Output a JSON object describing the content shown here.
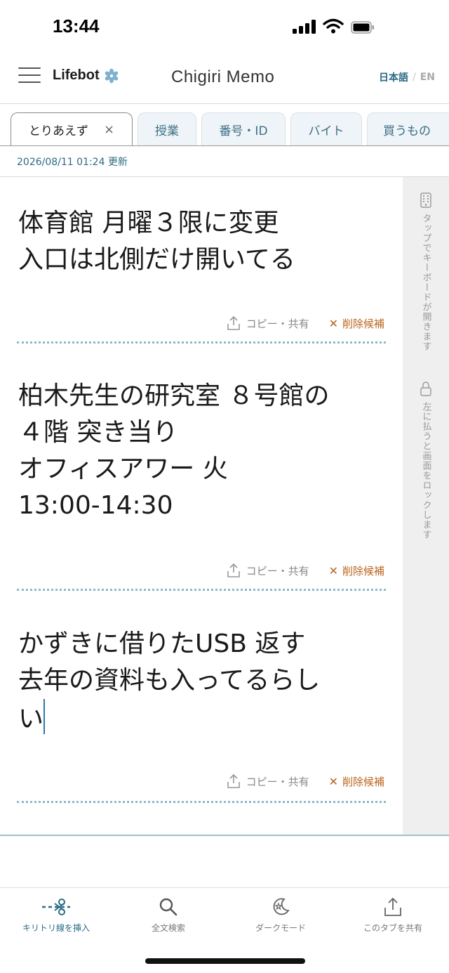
{
  "status_bar": {
    "time": "13:44"
  },
  "header": {
    "brand": "Lifebot",
    "title": "Chigiri Memo",
    "lang_ja": "日本語",
    "lang_sep": "/",
    "lang_en": "EN"
  },
  "tabs": [
    {
      "label": "とりあえず",
      "active": true,
      "close": "×"
    },
    {
      "label": "授業"
    },
    {
      "label": "番号・ID"
    },
    {
      "label": "バイト"
    },
    {
      "label": "買うもの"
    }
  ],
  "updated": "2026/08/11 01:24 更新",
  "memos": [
    {
      "text": "体育館 月曜３限に変更\n入口は北側だけ開いてる",
      "copy_label": "コピー・共有",
      "delete_label": "削除候補"
    },
    {
      "text": "柏木先生の研究室 ８号館の\n４階 突き当り\nオフィスアワー 火\n13:00-14:30",
      "copy_label": "コピー・共有",
      "delete_label": "削除候補"
    },
    {
      "text": "かずきに借りたUSB 返す\n去年の資料も入ってるらし\nい",
      "copy_label": "コピー・共有",
      "delete_label": "削除候補"
    }
  ],
  "side_rail": {
    "keyboard_hint": "タップでキーボードが開きます",
    "lock_hint": "左に払うと画面をロックします"
  },
  "bottom_nav": [
    {
      "label": "キリトリ線を挿入",
      "icon": "scissors-line-icon",
      "active": true
    },
    {
      "label": "全文検索",
      "icon": "search-icon"
    },
    {
      "label": "ダークモード",
      "icon": "moon-star-icon"
    },
    {
      "label": "このタブを共有",
      "icon": "share-icon"
    }
  ],
  "colors": {
    "accent": "#2e6c88",
    "delete": "#b9641c",
    "divider": "#8bb8cc"
  }
}
